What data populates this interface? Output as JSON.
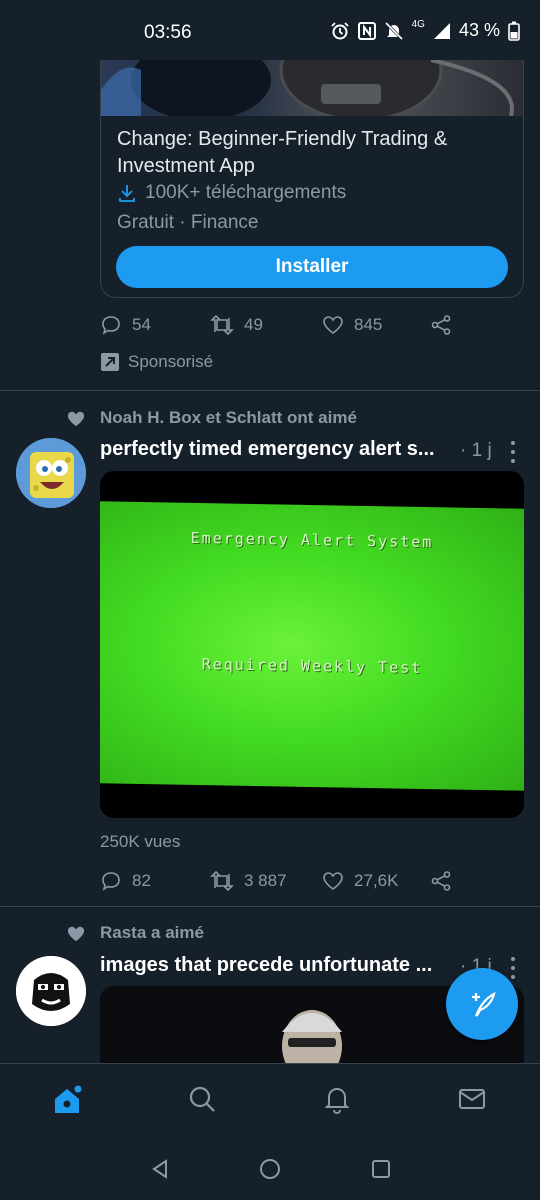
{
  "status_bar": {
    "time": "03:56",
    "network": "4G",
    "battery": "43 %"
  },
  "ad": {
    "title": "Change: Beginner-Friendly Trading & Investment App",
    "downloads": "100K+ téléchargements",
    "category": "Gratuit · Finance",
    "install_label": "Installer",
    "stats": {
      "replies": "54",
      "retweets": "49",
      "likes": "845"
    },
    "sponsored_label": "Sponsorisé"
  },
  "tweets": [
    {
      "social_context": "Noah H. Box et Schlatt ont aimé",
      "text": "perfectly timed emergency alert s...",
      "time": "· 1 j",
      "media_lines": [
        "Emergency Alert System",
        "Required Weekly Test"
      ],
      "views": "250K vues",
      "stats": {
        "replies": "82",
        "retweets": "3 887",
        "likes": "27,6K"
      }
    },
    {
      "social_context": "Rasta a aimé",
      "text": "images that precede unfortunate ...",
      "time": "· 1 j"
    }
  ],
  "colors": {
    "accent": "#1d9bf0",
    "background": "#15202b",
    "muted": "#8b98a5",
    "divider": "#38444d"
  },
  "icons": [
    "reply-icon",
    "retweet-icon",
    "like-icon",
    "share-icon",
    "home-icon",
    "search-icon",
    "bell-icon",
    "mail-icon",
    "compose-icon"
  ]
}
